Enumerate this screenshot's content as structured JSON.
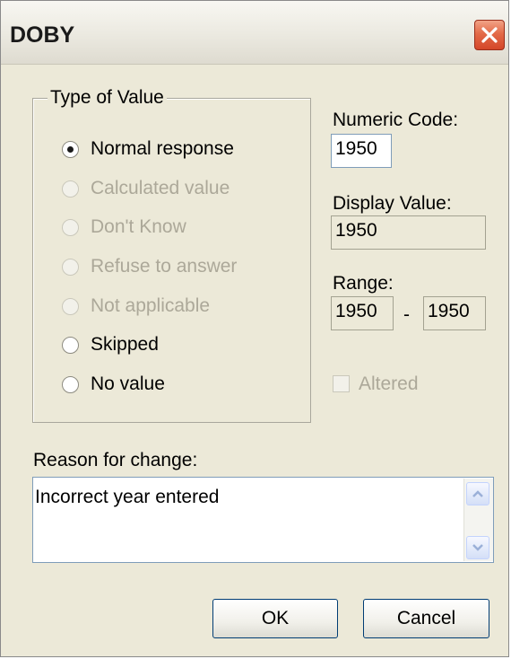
{
  "window": {
    "title": "DOBY",
    "close_icon": "close-x-icon"
  },
  "type_of_value": {
    "legend": "Type of Value",
    "options": [
      {
        "label": "Normal response",
        "checked": true,
        "enabled": true
      },
      {
        "label": "Calculated value",
        "checked": false,
        "enabled": false
      },
      {
        "label": "Don't Know",
        "checked": false,
        "enabled": false
      },
      {
        "label": "Refuse to answer",
        "checked": false,
        "enabled": false
      },
      {
        "label": "Not applicable",
        "checked": false,
        "enabled": false
      },
      {
        "label": "Skipped",
        "checked": false,
        "enabled": true
      },
      {
        "label": "No value",
        "checked": false,
        "enabled": true
      }
    ]
  },
  "numeric_code": {
    "label": "Numeric Code:",
    "value": "1950"
  },
  "display_value": {
    "label": "Display Value:",
    "value": "1950"
  },
  "range": {
    "label": "Range:",
    "from": "1950",
    "separator": "-",
    "to": "1950"
  },
  "altered": {
    "label": "Altered",
    "checked": false,
    "enabled": false
  },
  "reason": {
    "label": "Reason for change:",
    "value": "Incorrect year entered"
  },
  "buttons": {
    "ok": "OK",
    "cancel": "Cancel"
  }
}
